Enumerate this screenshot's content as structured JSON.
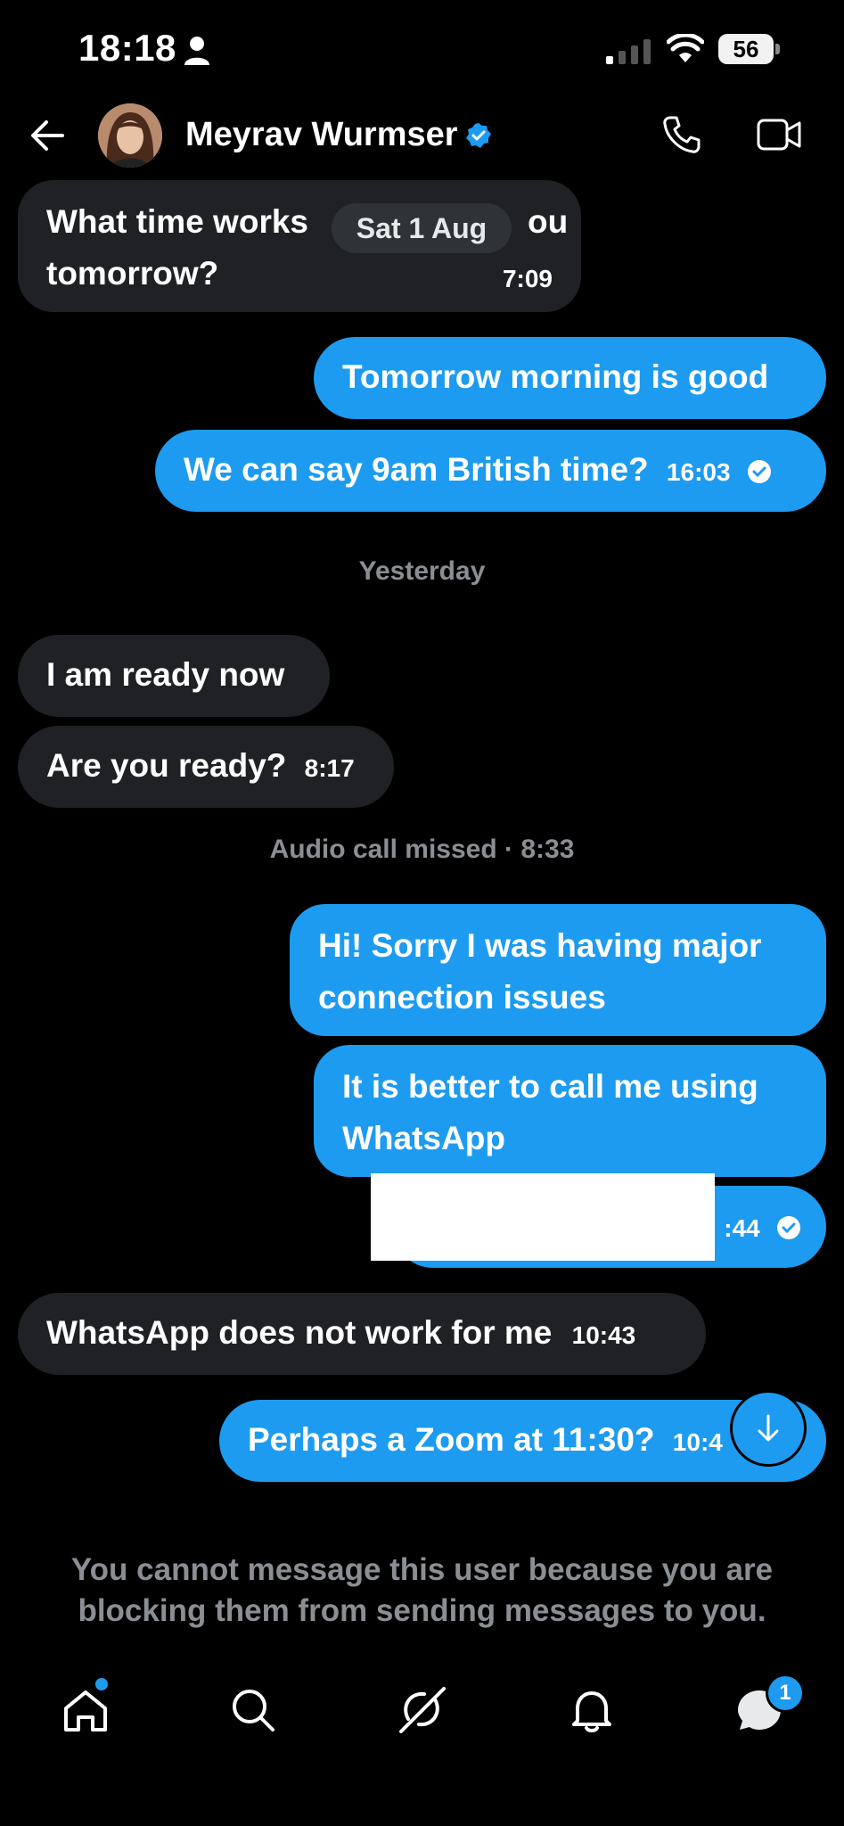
{
  "status_bar": {
    "time": "18:18",
    "battery": "56"
  },
  "header": {
    "contact_name": "Meyrav Wurmser"
  },
  "date_pill": "Sat 1 Aug",
  "messages": [
    {
      "dir": "in",
      "text_line1": "What time works",
      "text_line1_end": "ou",
      "text_line2": "tomorrow?",
      "time": "7:09"
    },
    {
      "dir": "out",
      "text": "Tomorrow morning is good"
    },
    {
      "dir": "out",
      "text": "We can say 9am British time?",
      "time": "16:03"
    },
    {
      "dir": "in",
      "text": "I am ready now"
    },
    {
      "dir": "in",
      "text": "Are you ready?",
      "time": "8:17"
    },
    {
      "dir": "out",
      "text_line1": "Hi! Sorry I was having major",
      "text_line2": "connection issues"
    },
    {
      "dir": "out",
      "text_line1": "It is better to call me using",
      "text_line2": "WhatsApp"
    },
    {
      "dir": "out",
      "time_partial": ":44"
    },
    {
      "dir": "in",
      "text": "WhatsApp does not work for me",
      "time": "10:43"
    },
    {
      "dir": "out",
      "text": "Perhaps a Zoom at 11:30?",
      "time_partial": "10:4"
    }
  ],
  "dividers": {
    "yesterday": "Yesterday",
    "missed_call": "Audio call missed · 8:33"
  },
  "blocked_notice": "You cannot message this user because you are blocking them from sending messages to you.",
  "bottom_nav": {
    "messages_badge": "1"
  }
}
